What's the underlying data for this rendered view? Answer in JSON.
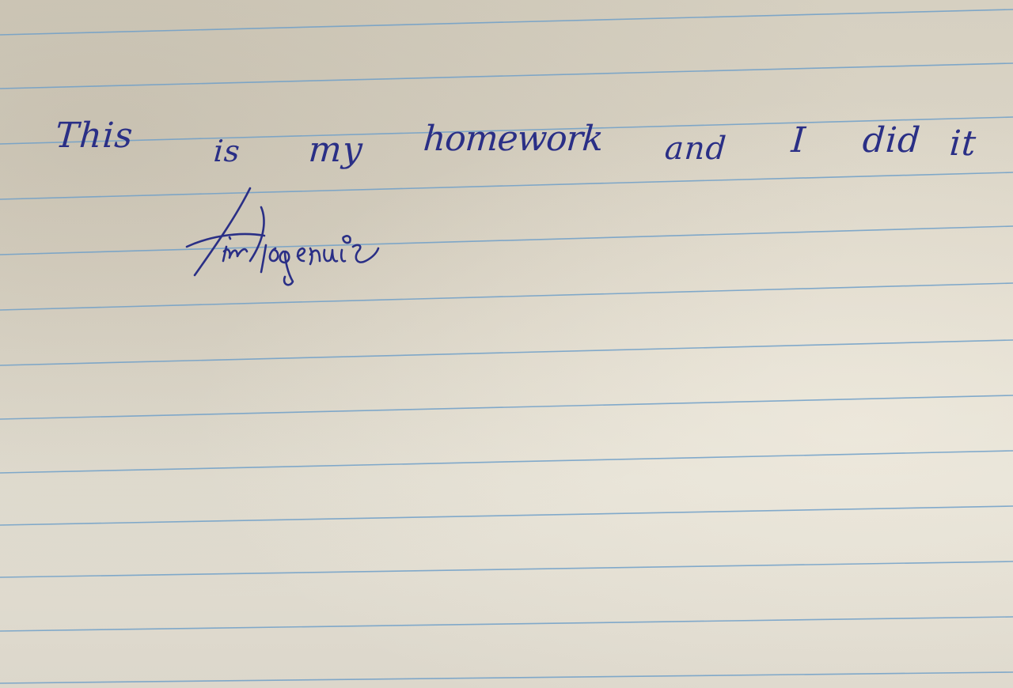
{
  "page": {
    "paper": "lined notebook paper",
    "ink_color": "#2a2f86",
    "rule_color": "#6f9fc8"
  },
  "handwriting": {
    "words": [
      "This",
      "is",
      "my",
      "homework",
      "and",
      "I",
      "did",
      "it"
    ]
  },
  "signature": {
    "text": "Tim Kogenić",
    "style": "handwritten-signature"
  }
}
